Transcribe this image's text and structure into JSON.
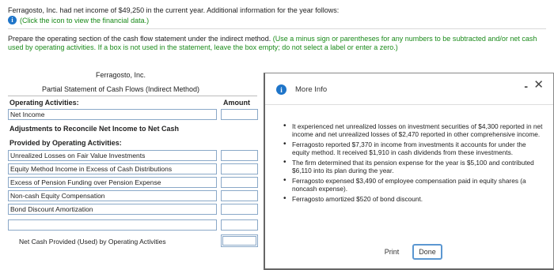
{
  "intro": "Ferragosto, Inc. had net income of $49,250 in the current year. Additional information for the year follows:",
  "hint": "(Click the icon to view the financial data.)",
  "instructions_plain": "Prepare the operating section of the cash flow statement under the indirect method. ",
  "instructions_green": "(Use a minus sign or parentheses for any numbers to be subtracted and/or net cash used by operating activities. If a box is not used in the statement, leave the box empty; do not select a label or enter a zero.)",
  "statement": {
    "company": "Ferragosto, Inc.",
    "title": "Partial Statement of Cash Flows (Indirect Method)",
    "section": "Operating Activities:",
    "amount_header": "Amount",
    "net_income_label": "Net Income",
    "adjust_line1": "Adjustments to Reconcile Net Income to Net Cash",
    "adjust_line2": "Provided by Operating Activities:",
    "rows": [
      "Unrealized Losses on Fair Value Investments",
      "Equity Method Income in Excess of Cash Distributions",
      "Excess of Pension Funding over Pension Expense",
      "Non-cash Equity Compensation",
      "Bond Discount Amortization",
      ""
    ],
    "net_cash_label": "Net Cash Provided (Used) by Operating Activities"
  },
  "modal": {
    "title": "More Info",
    "minimize": "-",
    "close": "✕",
    "items": [
      "It experienced net unrealized losses on investment securities of $4,300 reported in net income and net unrealized losses of $2,470 reported in other comprehensive income.",
      "Ferragosto reported $7,370 in income from investments it accounts for under the equity method. It received $1,910 in cash dividends from these investments.",
      "The firm determined that its pension expense for the year is $5,100 and contributed $6,110 into its plan during the year.",
      "Ferragosto expensed $3,490 of employee compensation paid in equity shares (a noncash expense).",
      "Ferragosto amortized $520 of bond discount."
    ],
    "print_label": "Print",
    "done_label": "Done"
  },
  "colors": {
    "info_icon": "#1f75c9",
    "hint_green": "#1a8a1a",
    "field_border": "#8aa8c8"
  },
  "icons": {
    "info": "info-icon",
    "close": "close-icon",
    "minimize": "minimize-icon"
  }
}
